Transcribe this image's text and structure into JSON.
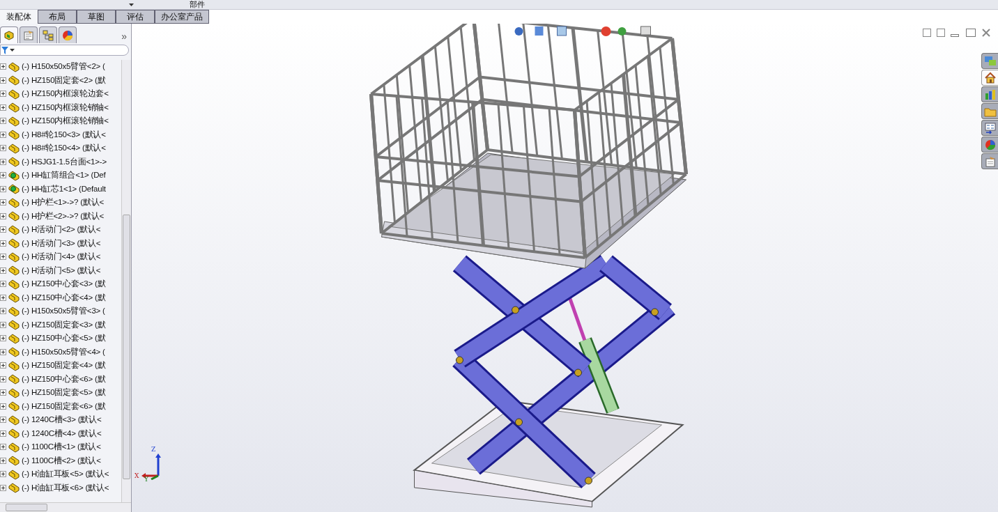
{
  "command_manager": {
    "group_label": "部件"
  },
  "tabs": [
    {
      "label": "装配体",
      "selected": true
    },
    {
      "label": "布局",
      "selected": false
    },
    {
      "label": "草图",
      "selected": false
    },
    {
      "label": "评估",
      "selected": false
    },
    {
      "label": "办公室产品",
      "selected": false
    }
  ],
  "panel_tabs": [
    {
      "kind": "tree",
      "selected": true
    },
    {
      "kind": "property",
      "selected": false
    },
    {
      "kind": "config",
      "selected": false
    },
    {
      "kind": "appearance",
      "selected": false
    }
  ],
  "panel_more": "»",
  "tree": {
    "items": [
      {
        "kind": "part",
        "text": "(-) H150x50x5臂管<2> ("
      },
      {
        "kind": "part",
        "text": "(-) HZ150固定套<2> (默"
      },
      {
        "kind": "part",
        "text": "(-) HZ150内框滚轮边套<"
      },
      {
        "kind": "part",
        "text": "(-) HZ150内框滚轮销轴<"
      },
      {
        "kind": "part",
        "text": "(-) HZ150内框滚轮销轴<"
      },
      {
        "kind": "part",
        "text": "(-) H8#轮150<3> (默认<"
      },
      {
        "kind": "part",
        "text": "(-) H8#轮150<4> (默认<"
      },
      {
        "kind": "part",
        "text": "(-) HSJG1-1.5台面<1>->"
      },
      {
        "kind": "assembly",
        "text": "(-) HH缸筒组合<1> (Def"
      },
      {
        "kind": "assembly",
        "text": "(-) HH缸芯1<1> (Default"
      },
      {
        "kind": "part",
        "text": "(-) H护栏<1>->? (默认<"
      },
      {
        "kind": "part",
        "text": "(-) H护栏<2>->? (默认<"
      },
      {
        "kind": "part",
        "text": "(-) H活动门<2> (默认<"
      },
      {
        "kind": "part",
        "text": "(-) H活动门<3> (默认<"
      },
      {
        "kind": "part",
        "text": "(-) H活动门<4> (默认<"
      },
      {
        "kind": "part",
        "text": "(-) H活动门<5> (默认<"
      },
      {
        "kind": "part",
        "text": "(-) HZ150中心套<3> (默"
      },
      {
        "kind": "part",
        "text": "(-) HZ150中心套<4> (默"
      },
      {
        "kind": "part",
        "text": "(-) H150x50x5臂管<3> ("
      },
      {
        "kind": "part",
        "text": "(-) HZ150固定套<3> (默"
      },
      {
        "kind": "part",
        "text": "(-) HZ150中心套<5> (默"
      },
      {
        "kind": "part",
        "text": "(-) H150x50x5臂管<4> ("
      },
      {
        "kind": "part",
        "text": "(-) HZ150固定套<4> (默"
      },
      {
        "kind": "part",
        "text": "(-) HZ150中心套<6> (默"
      },
      {
        "kind": "part",
        "text": "(-) HZ150固定套<5> (默"
      },
      {
        "kind": "part",
        "text": "(-) HZ150固定套<6> (默"
      },
      {
        "kind": "part",
        "text": "(-) 1240C槽<3> (默认<"
      },
      {
        "kind": "part",
        "text": "(-) 1240C槽<4> (默认<"
      },
      {
        "kind": "part",
        "text": "(-) 1100C槽<1> (默认<"
      },
      {
        "kind": "part",
        "text": "(-) 1100C槽<2> (默认<"
      },
      {
        "kind": "part",
        "text": "(-) H油缸耳板<5> (默认<"
      },
      {
        "kind": "part",
        "text": "(-) H油缸耳板<6> (默认<"
      }
    ]
  },
  "task_pane": {
    "tabs": [
      {
        "kind": "forum",
        "selected": false
      },
      {
        "kind": "home",
        "selected": true
      },
      {
        "kind": "library",
        "selected": false
      },
      {
        "kind": "folder",
        "selected": false
      },
      {
        "kind": "palette",
        "selected": false
      },
      {
        "kind": "appearance",
        "selected": false
      },
      {
        "kind": "properties",
        "selected": false
      }
    ]
  },
  "triad": {
    "x": "X",
    "y": "Y",
    "z": "Z"
  }
}
